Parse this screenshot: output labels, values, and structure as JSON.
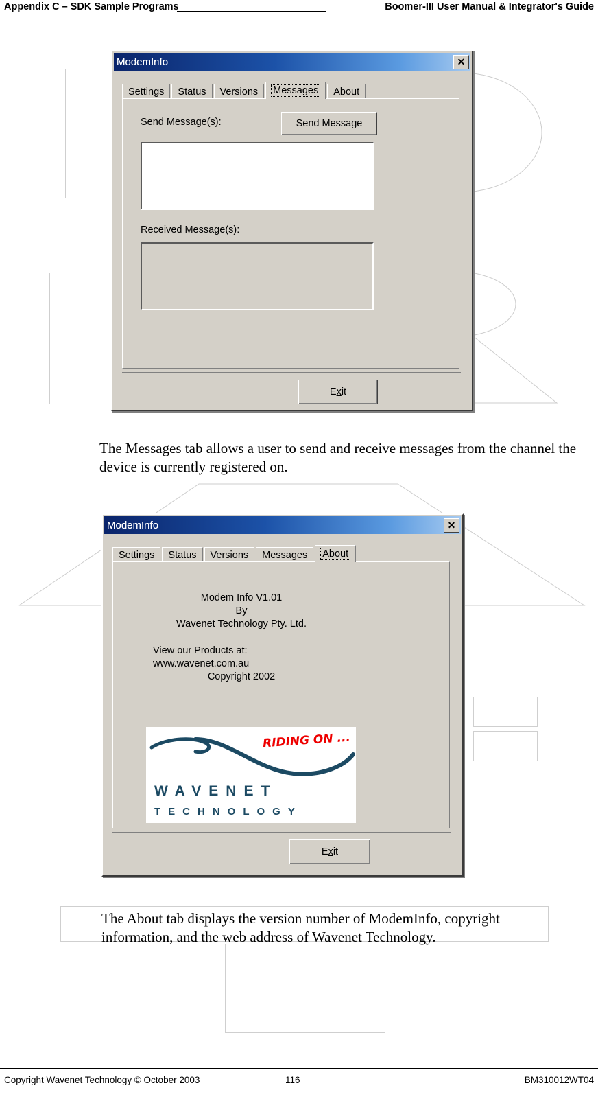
{
  "page": {
    "header": {
      "left": "Appendix C – SDK Sample Programs",
      "right": "Boomer-III User Manual & Integrator's Guide"
    },
    "footer": {
      "copyright": "Copyright Wavenet Technology © October 2003",
      "page_number": "116",
      "doc_code": "BM310012WT04"
    }
  },
  "colors": {
    "title_gradient_start": "#0a246a",
    "title_gradient_end": "#a6caf0",
    "dialog_face": "#d4d0c8",
    "logo_teal": "#1c4a63",
    "logo_red": "#ee0000"
  },
  "dialog_messages": {
    "title": "ModemInfo",
    "close_label": "✕",
    "tabs": [
      {
        "label": "Settings",
        "selected": false
      },
      {
        "label": "Status",
        "selected": false
      },
      {
        "label": "Versions",
        "selected": false
      },
      {
        "label": "Messages",
        "selected": true
      },
      {
        "label": "About",
        "selected": false
      }
    ],
    "send_label": "Send Message(s):",
    "send_button": "Send Message",
    "send_value": "",
    "received_label": "Received Message(s):",
    "received_value": "",
    "exit_button": {
      "prefix": "E",
      "accel": "x",
      "suffix": "it"
    }
  },
  "paragraph_messages": "The Messages tab allows a user to send and receive messages from the channel the device is currently registered on.",
  "dialog_about": {
    "title": "ModemInfo",
    "close_label": "✕",
    "tabs": [
      {
        "label": "Settings",
        "selected": false
      },
      {
        "label": "Status",
        "selected": false
      },
      {
        "label": "Versions",
        "selected": false
      },
      {
        "label": "Messages",
        "selected": false
      },
      {
        "label": "About",
        "selected": true
      }
    ],
    "about_line1": "Modem Info V1.01",
    "about_line2": "By",
    "about_line3": "Wavenet Technology Pty. Ltd.",
    "about_line4": "View our Products at:",
    "about_line5": "www.wavenet.com.au",
    "about_line6": "Copyright 2002",
    "logo": {
      "tagline": "RIDING ON ...",
      "word_top": "WAVENET",
      "word_bottom": "TECHNOLOGY"
    },
    "exit_button": {
      "prefix": "E",
      "accel": "x",
      "suffix": "it"
    }
  },
  "paragraph_about": "The About tab displays the version number of ModemInfo, copyright information, and the web address of Wavenet Technology."
}
